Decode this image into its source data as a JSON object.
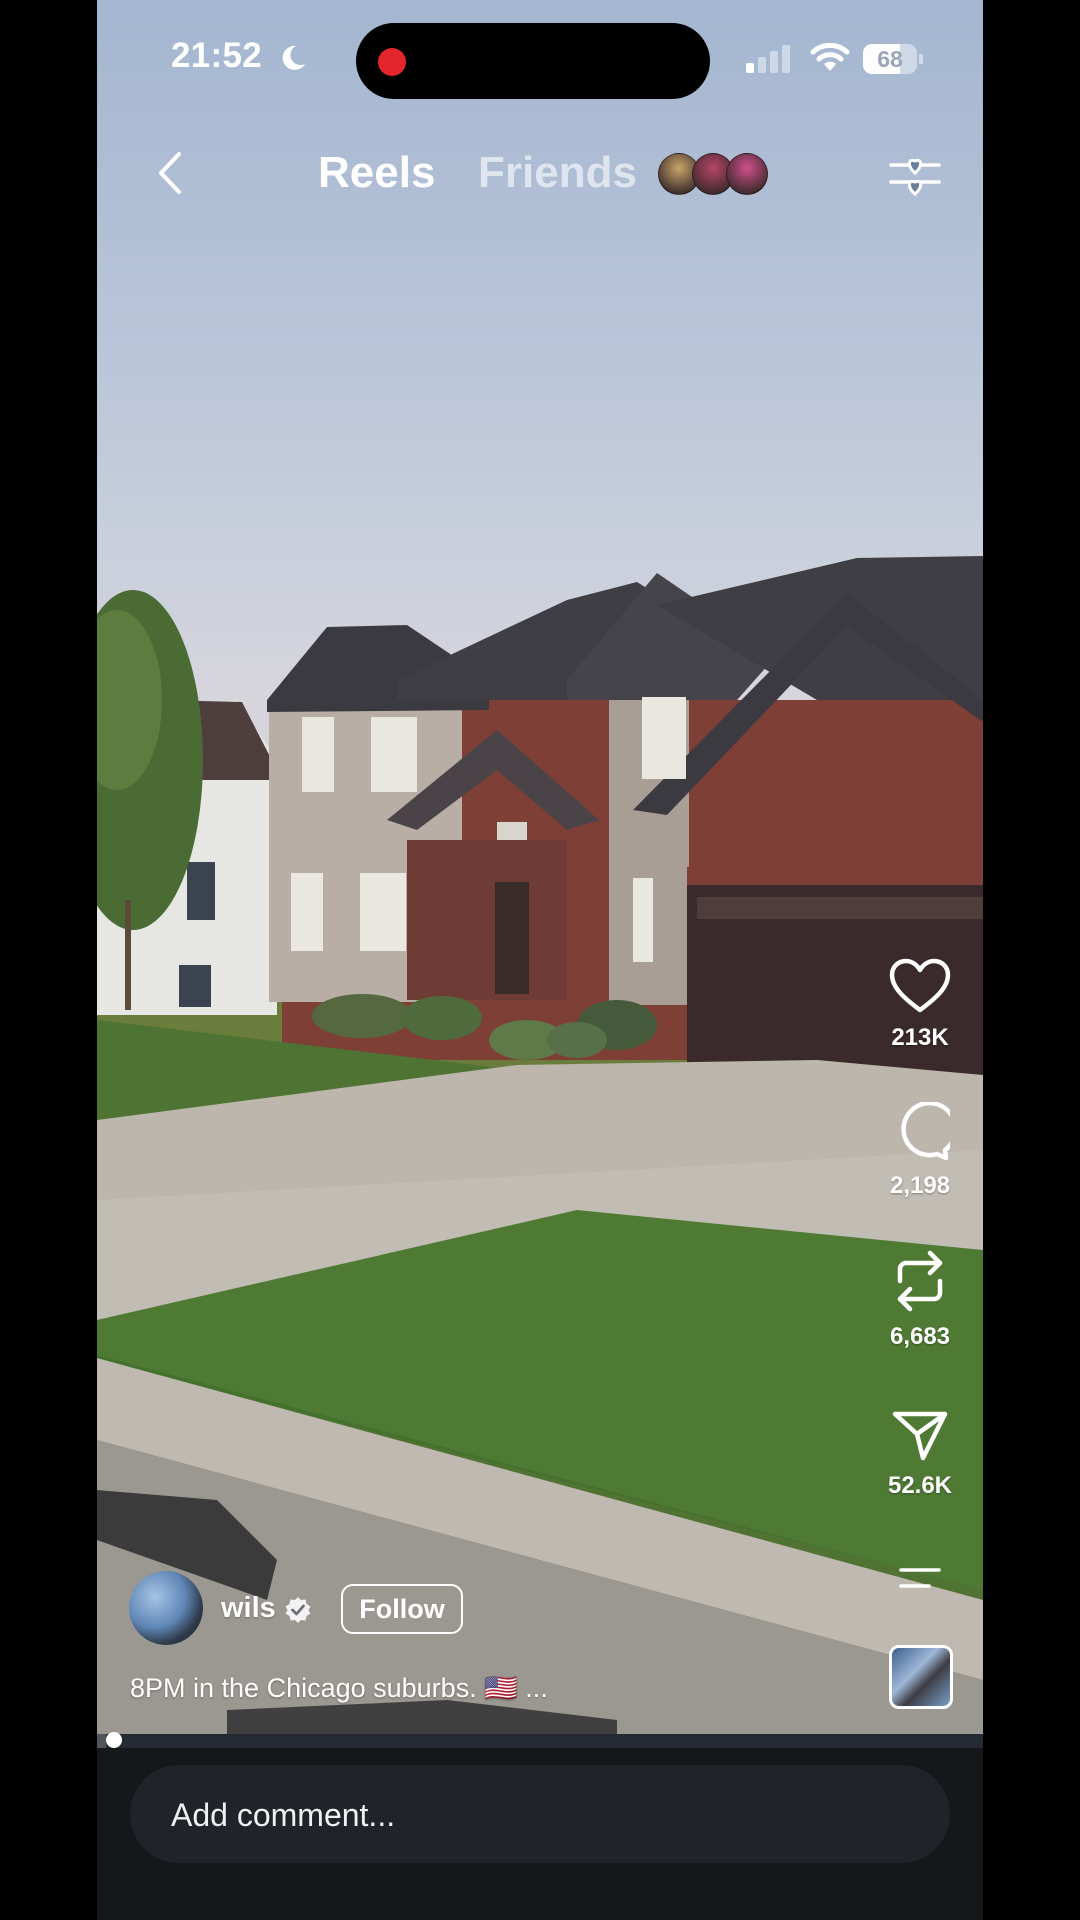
{
  "status_bar": {
    "time": "21:52",
    "battery": "68",
    "battery_level": 0.68,
    "icons": [
      "moon-icon",
      "recording-dot",
      "signal-icon",
      "wifi-icon",
      "battery-icon"
    ]
  },
  "top_nav": {
    "tabs": [
      {
        "label": "Reels",
        "active": true
      },
      {
        "label": "Friends",
        "active": false
      }
    ],
    "friend_avatar_colors": [
      "#c9a46a",
      "#b8456a",
      "#d04f8a"
    ],
    "icons": [
      "back-icon",
      "filter-icon"
    ]
  },
  "actions": {
    "like": {
      "count": "213K",
      "icon": "heart-icon"
    },
    "comment": {
      "count": "2,198",
      "icon": "comment-icon"
    },
    "repost": {
      "count": "6,683",
      "icon": "repost-icon"
    },
    "share": {
      "count": "52.6K",
      "icon": "send-icon"
    },
    "more": {
      "icon": "menu-icon"
    }
  },
  "post": {
    "author": "wils",
    "verified": true,
    "follow_label": "Follow",
    "caption": "8PM in the Chicago suburbs. 🇺🇸  ..."
  },
  "playback": {
    "progress": 0.01
  },
  "comment_box": {
    "placeholder": "Add comment..."
  },
  "colors": {
    "accent": "#ffffff",
    "recording": "#e3262c",
    "background": "#15171b",
    "input": "#202329"
  }
}
